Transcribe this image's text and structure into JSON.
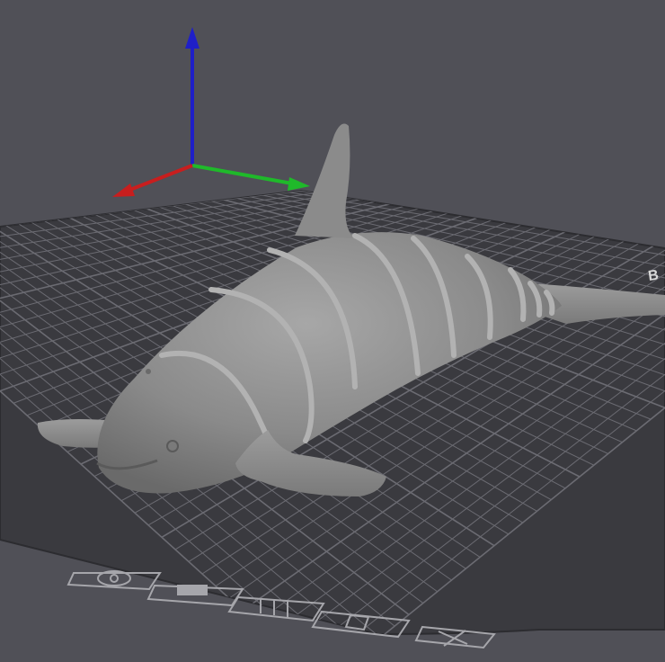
{
  "viewport": {
    "background": "#505057",
    "bed_color": "#3a3a3f",
    "grid_color": "#6b6b72",
    "model_color": "#8e8e8e"
  },
  "axes": {
    "x_color": "#c81e1e",
    "y_color": "#1fb92a",
    "z_color": "#1f1fc8"
  },
  "bed": {
    "corner_label": "B",
    "printer_icons": [
      "eye-icon",
      "nozzle-icon",
      "spool-icon",
      "settings-icon",
      "close-icon"
    ]
  },
  "model": {
    "name": "articulated-orca"
  }
}
